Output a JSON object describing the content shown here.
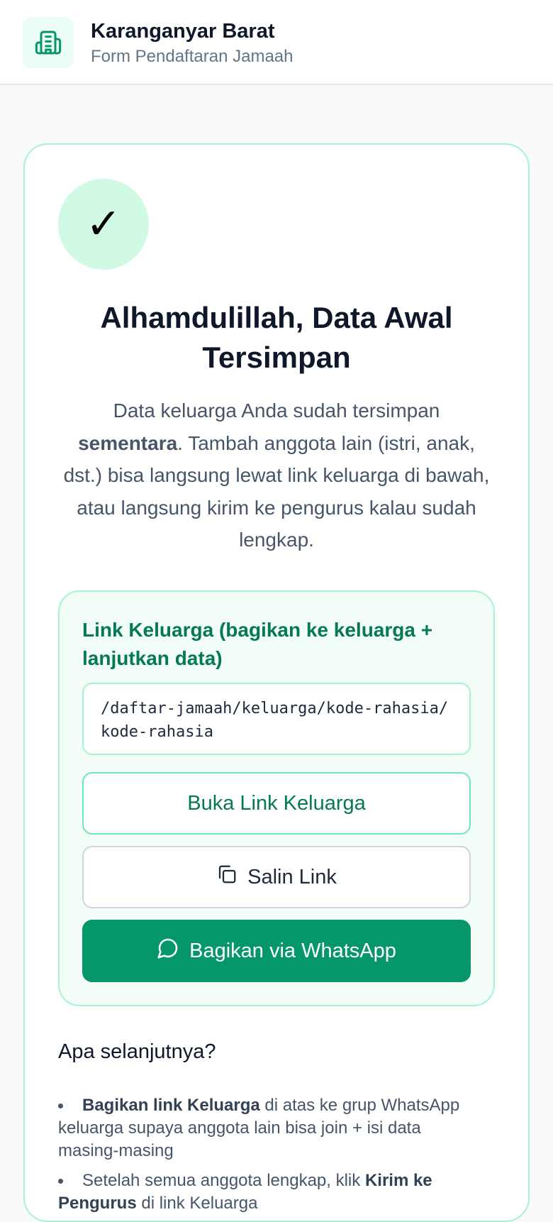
{
  "header": {
    "title": "Karanganyar Barat",
    "subtitle": "Form Pendaftaran Jamaah",
    "logo_icon": "building-icon"
  },
  "success": {
    "icon": "check-icon",
    "heading": "Alhamdulillah, Data Awal Tersimpan",
    "desc_part1": "Data keluarga Anda sudah tersimpan ",
    "desc_bold": "sementara",
    "desc_part2": ". Tambah anggota lain (istri, anak, dst.) bisa langsung lewat link keluarga di bawah, atau langsung kirim ke pengurus kalau sudah lengkap."
  },
  "family_link": {
    "label": "Link Keluarga (bagikan ke keluarga + lanjutkan data)",
    "value": "/daftar-jamaah/keluarga/kode-rahasia/kode-rahasia",
    "open_label": "Buka Link Keluarga",
    "copy_label": "Salin Link",
    "share_label": "Bagikan via WhatsApp"
  },
  "next_steps": {
    "title": "Apa selanjutnya?",
    "step1_bold": "Bagikan link Keluarga",
    "step1_rest": " di atas ke grup WhatsApp keluarga supaya anggota lain bisa join + isi data masing-masing",
    "step2_start": "Setelah semua anggota lengkap, klik ",
    "step2_bold": "Kirim ke Pengurus",
    "step2_rest": " di link Keluarga"
  },
  "colors": {
    "accent": "#059669",
    "accent_dark": "#047857",
    "border_green": "#a7f3d0",
    "check_bg": "#d1fae5"
  }
}
